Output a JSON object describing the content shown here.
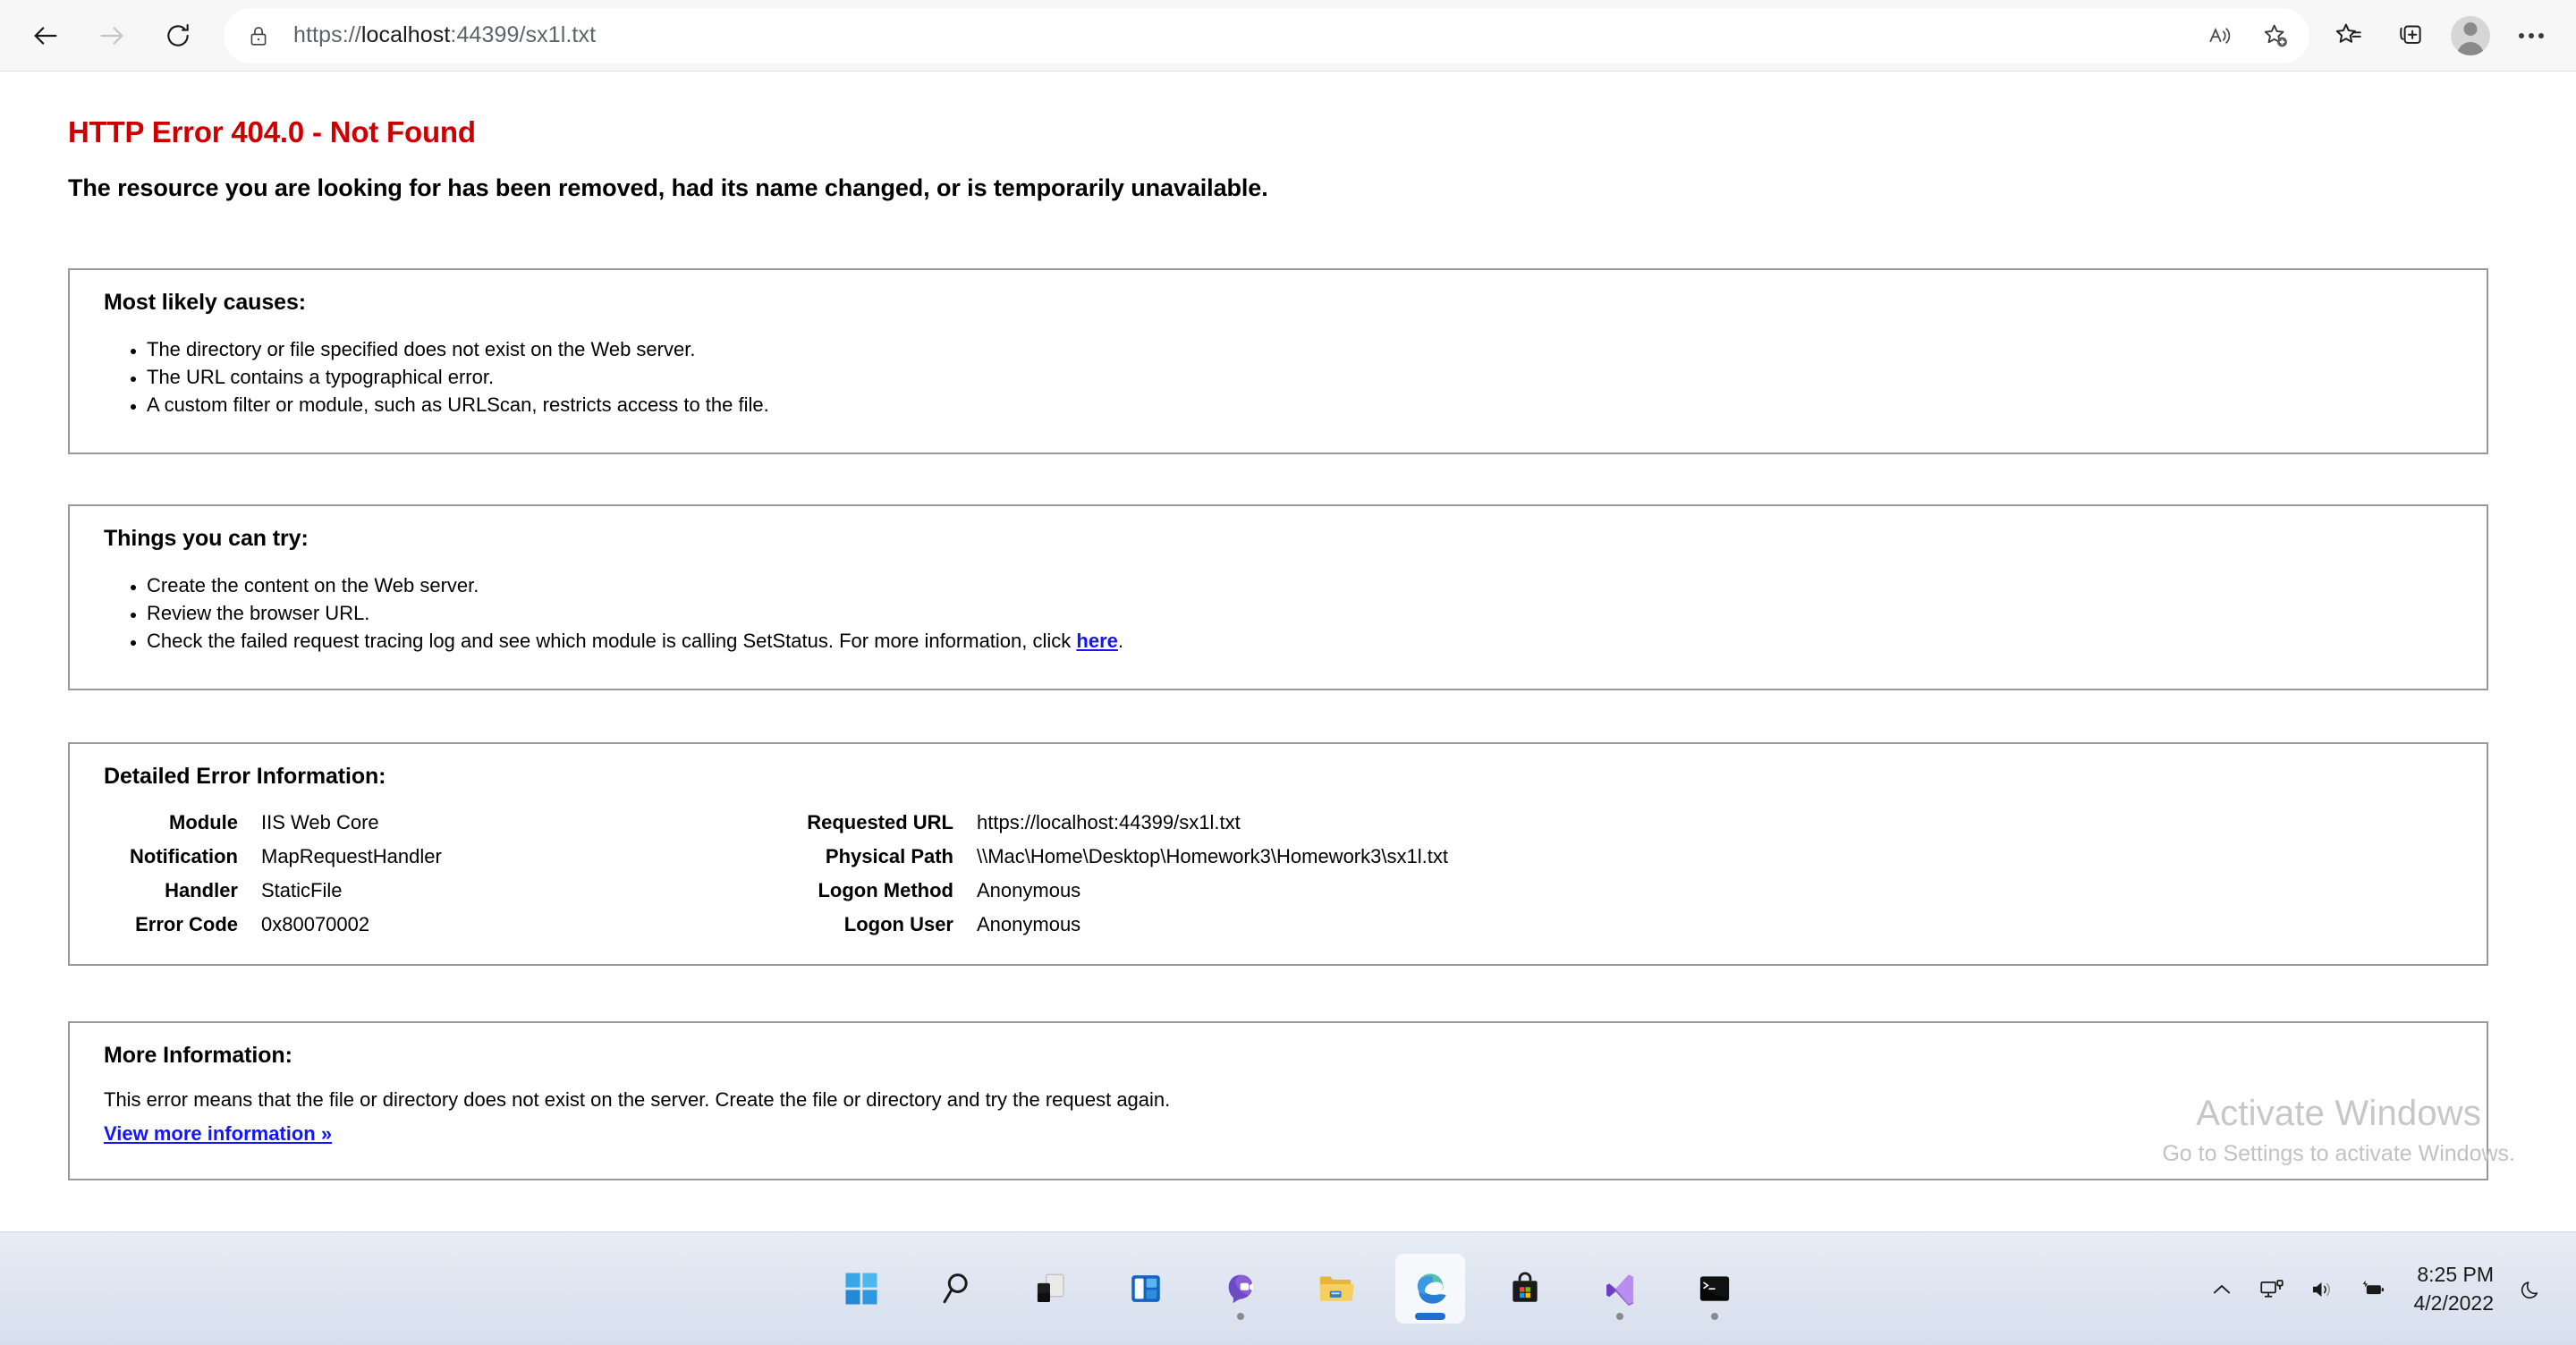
{
  "browser": {
    "back_label": "Back",
    "forward_label": "Forward",
    "reload_label": "Refresh",
    "url_scheme": "https://",
    "url_host": "localhost",
    "url_rest": ":44399/sx1l.txt",
    "url_full": "https://localhost:44399/sx1l.txt",
    "lock_icon": "lock-icon",
    "read_aloud_icon": "read-aloud-icon",
    "add_favorite_icon": "add-favorite-icon",
    "favorites_icon": "favorites-icon",
    "collections_icon": "collections-icon",
    "profile_icon": "profile-avatar-icon",
    "settings_icon": "more-options-icon"
  },
  "error": {
    "title": "HTTP Error 404.0 - Not Found",
    "subtitle": "The resource you are looking for has been removed, had its name changed, or is temporarily unavailable.",
    "title_color": "#CC0000",
    "link_color": "#1414FF",
    "panel_border_color": "#999999"
  },
  "causes": {
    "heading": "Most likely causes:",
    "items": [
      "The directory or file specified does not exist on the Web server.",
      "The URL contains a typographical error.",
      "A custom filter or module, such as URLScan, restricts access to the file."
    ]
  },
  "things_to_try": {
    "heading": "Things you can try:",
    "items": [
      "Create the content on the Web server.",
      "Review the browser URL."
    ],
    "last_item_prefix": "Check the failed request tracing log and see which module is calling SetStatus. For more information, click ",
    "last_item_link": "here",
    "last_item_suffix": "."
  },
  "detailed": {
    "heading": "Detailed Error Information:",
    "left": [
      {
        "key": "Module",
        "value": "IIS Web Core"
      },
      {
        "key": "Notification",
        "value": "MapRequestHandler"
      },
      {
        "key": "Handler",
        "value": "StaticFile"
      },
      {
        "key": "Error Code",
        "value": "0x80070002"
      }
    ],
    "right": [
      {
        "key": "Requested URL",
        "value": "https://localhost:44399/sx1l.txt"
      },
      {
        "key": "Physical Path",
        "value": "\\\\Mac\\Home\\Desktop\\Homework3\\Homework3\\sx1l.txt"
      },
      {
        "key": "Logon Method",
        "value": "Anonymous"
      },
      {
        "key": "Logon User",
        "value": "Anonymous"
      }
    ]
  },
  "more_info": {
    "heading": "More Information:",
    "text": "This error means that the file or directory does not exist on the server. Create the file or directory and try the request again.",
    "link": "View more information »"
  },
  "watermark": {
    "title": "Activate Windows",
    "subtitle": "Go to Settings to activate Windows."
  },
  "taskbar": {
    "items": [
      {
        "name": "start-button",
        "label": "Start"
      },
      {
        "name": "search-button",
        "label": "Search"
      },
      {
        "name": "task-view-button",
        "label": "Task View"
      },
      {
        "name": "widgets-button",
        "label": "Widgets"
      },
      {
        "name": "chat-button",
        "label": "Chat"
      },
      {
        "name": "file-explorer-button",
        "label": "File Explorer"
      },
      {
        "name": "edge-button",
        "label": "Microsoft Edge"
      },
      {
        "name": "microsoft-store-button",
        "label": "Microsoft Store"
      },
      {
        "name": "visual-studio-button",
        "label": "Visual Studio"
      },
      {
        "name": "terminal-button",
        "label": "Terminal"
      }
    ],
    "tray": {
      "show_hidden_icons": "chevron-up-icon",
      "network_icon": "network-icon",
      "volume_icon": "volume-icon",
      "battery_icon": "battery-charging-icon",
      "time": "8:25 PM",
      "date": "4/2/2022",
      "notifications_icon": "do-not-disturb-icon"
    }
  }
}
